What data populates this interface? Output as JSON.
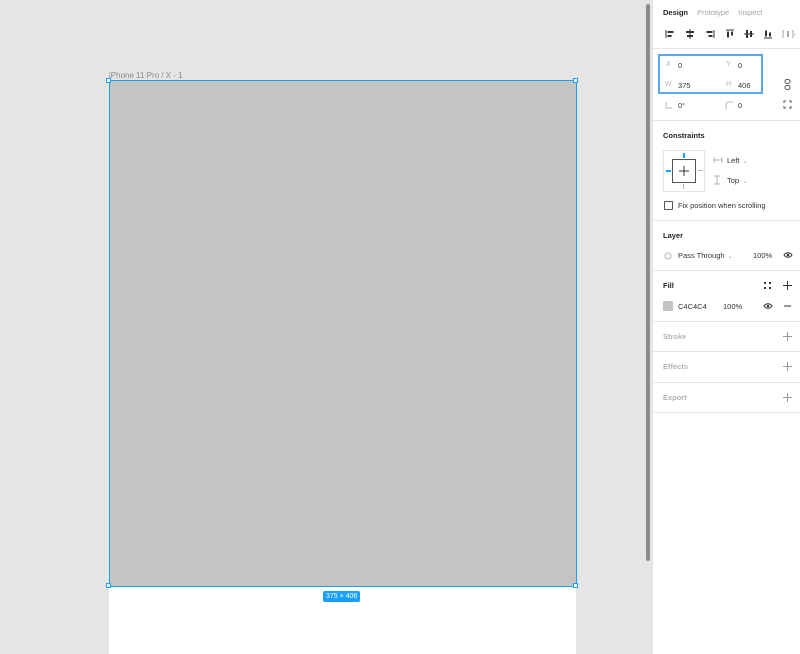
{
  "canvas": {
    "frame_label": "iPhone 11 Pro / X - 1",
    "dimension_badge": "375 × 406",
    "frame_fill": "#C4C4C4",
    "selection_color": "#18A0FB"
  },
  "panel": {
    "tabs": [
      {
        "label": "Design",
        "active": true
      },
      {
        "label": "Prototype",
        "active": false
      },
      {
        "label": "Inspect",
        "active": false
      }
    ],
    "align_icons": [
      "align-left-icon",
      "align-horizontal-center-icon",
      "align-right-icon",
      "align-top-icon",
      "align-vertical-center-icon",
      "align-bottom-icon",
      "distribute-icon"
    ],
    "props": {
      "x_label": "X",
      "x_value": "0",
      "y_label": "Y",
      "y_value": "0",
      "w_label": "W",
      "w_value": "375",
      "h_label": "H",
      "h_value": "406",
      "rotation_value": "0°",
      "radius_value": "0"
    },
    "constraints": {
      "title": "Constraints",
      "horizontal": "Left",
      "vertical": "Top",
      "fix_label": "Fix position when scrolling"
    },
    "layer": {
      "title": "Layer",
      "blend": "Pass Through",
      "opacity": "100%"
    },
    "fill": {
      "title": "Fill",
      "hex": "C4C4C4",
      "opacity": "100%"
    },
    "stroke": {
      "title": "Stroke"
    },
    "effects": {
      "title": "Effects"
    },
    "export": {
      "title": "Export"
    }
  }
}
